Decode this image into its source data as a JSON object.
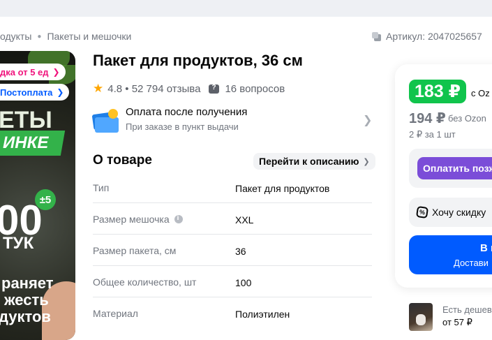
{
  "breadcrumb": [
    "одукты",
    "Пакеты и мешочки"
  ],
  "article": {
    "label": "Артикул: 2047025657",
    "icon": "copy-icon"
  },
  "image_overlay": {
    "badge_1": "дка от 5 ед",
    "badge_2": "Постоплата",
    "line_1": "ЕТЫ",
    "line_2": "ИНКЕ",
    "number": "00",
    "plus": "±5",
    "line_3": "ТУК",
    "line_4": "раняет",
    "line_5": "жесть",
    "line_6": "дуктов"
  },
  "product": {
    "title": "Пакет для продуктов, 36 см",
    "rating": "4.8",
    "reviews": "52 794 отзыва",
    "questions": "16 вопросов"
  },
  "payment": {
    "title": "Оплата после получения",
    "subtitle": "При заказе в пункт выдачи"
  },
  "about": {
    "title": "О товаре",
    "goto_label": "Перейти к описанию",
    "specs": [
      {
        "key": "Тип",
        "value": "Пакет для продуктов",
        "info": false
      },
      {
        "key": "Размер мешочка",
        "value": "XXL",
        "info": true
      },
      {
        "key": "Размер пакета, см",
        "value": "36",
        "info": false
      },
      {
        "key": "Общее количество, шт",
        "value": "100",
        "info": false
      },
      {
        "key": "Материал",
        "value": "Полиэтилен",
        "info": false
      }
    ]
  },
  "price": {
    "ozon_price": "183 ₽",
    "ozon_label": "с Oz",
    "regular_price": "194 ₽",
    "regular_label": "без Ozon",
    "unit_price": "2 ₽ за 1 шт",
    "pay_later": "Оплатить позж",
    "discount": "Хочу скидку",
    "cart_line_1": "В к",
    "cart_line_2": "Достави"
  },
  "cheaper": {
    "line_1": "Есть дешев",
    "line_2": "от 57 ₽"
  },
  "colors": {
    "ozon_green": "#10c44c",
    "ozon_blue": "#005bff",
    "pay_later_purple": "#7b4dd8",
    "star": "#ffa600"
  }
}
